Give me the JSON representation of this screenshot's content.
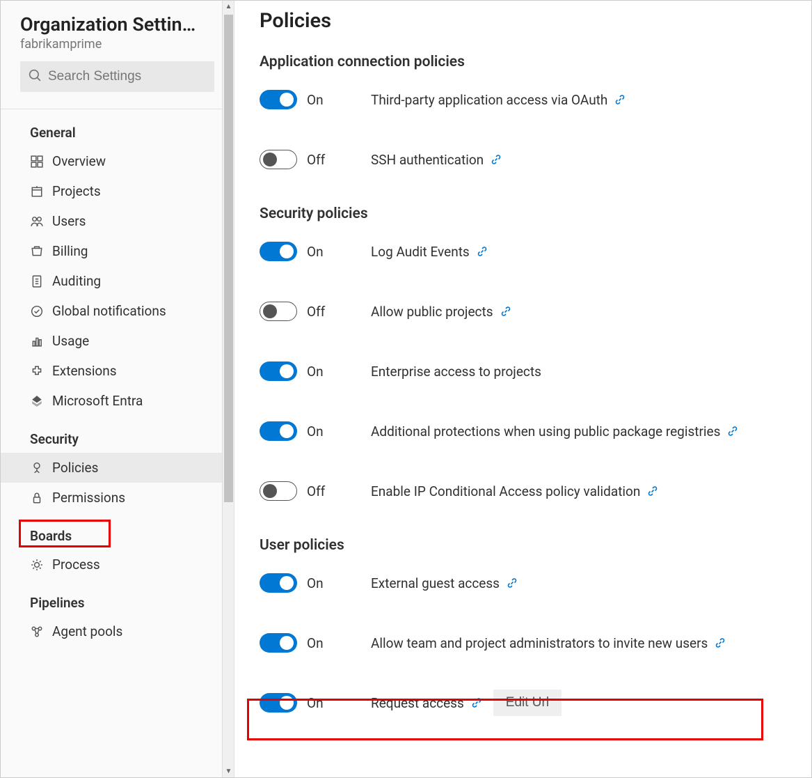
{
  "sidebar": {
    "title": "Organization Settin…",
    "subtitle": "fabrikamprime",
    "search_placeholder": "Search Settings",
    "sections": [
      {
        "title": "General",
        "items": [
          {
            "label": "Overview",
            "icon": "overview"
          },
          {
            "label": "Projects",
            "icon": "projects"
          },
          {
            "label": "Users",
            "icon": "users"
          },
          {
            "label": "Billing",
            "icon": "billing"
          },
          {
            "label": "Auditing",
            "icon": "auditing"
          },
          {
            "label": "Global notifications",
            "icon": "notifications"
          },
          {
            "label": "Usage",
            "icon": "usage"
          },
          {
            "label": "Extensions",
            "icon": "extensions"
          },
          {
            "label": "Microsoft Entra",
            "icon": "entra"
          }
        ]
      },
      {
        "title": "Security",
        "items": [
          {
            "label": "Policies",
            "icon": "policies",
            "active": true
          },
          {
            "label": "Permissions",
            "icon": "permissions"
          }
        ]
      },
      {
        "title": "Boards",
        "items": [
          {
            "label": "Process",
            "icon": "process"
          }
        ]
      },
      {
        "title": "Pipelines",
        "items": [
          {
            "label": "Agent pools",
            "icon": "agentpools"
          }
        ]
      }
    ]
  },
  "main": {
    "page_title": "Policies",
    "toggle_on_label": "On",
    "toggle_off_label": "Off",
    "edit_url_label": "Edit Url",
    "sections": [
      {
        "title": "Application connection policies",
        "policies": [
          {
            "on": true,
            "label": "Third-party application access via OAuth",
            "link": true
          },
          {
            "on": false,
            "label": "SSH authentication",
            "link": true
          }
        ]
      },
      {
        "title": "Security policies",
        "policies": [
          {
            "on": true,
            "label": "Log Audit Events",
            "link": true
          },
          {
            "on": false,
            "label": "Allow public projects",
            "link": true
          },
          {
            "on": true,
            "label": "Enterprise access to projects",
            "link": false
          },
          {
            "on": true,
            "label": "Additional protections when using public package registries",
            "link": true
          },
          {
            "on": false,
            "label": "Enable IP Conditional Access policy validation",
            "link": true
          }
        ]
      },
      {
        "title": "User policies",
        "policies": [
          {
            "on": true,
            "label": "External guest access",
            "link": true
          },
          {
            "on": true,
            "label": "Allow team and project administrators to invite new users",
            "link": true
          },
          {
            "on": true,
            "label": "Request access",
            "link": true,
            "edit_url": true
          }
        ]
      }
    ]
  }
}
